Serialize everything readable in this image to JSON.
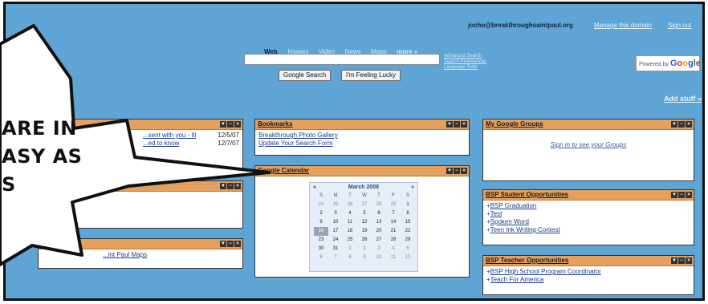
{
  "header": {
    "email": "jocho@breakthroughsaintpaul.org",
    "manage_label": "Manage this domain",
    "signout_label": "Sign out"
  },
  "search": {
    "tabs": [
      "Web",
      "Images",
      "Video",
      "News",
      "Maps",
      "more »"
    ],
    "google_search": "Google Search",
    "lucky": "I'm Feeling Lucky",
    "side_links": [
      "Advanced Search",
      "Search Preferences",
      "Language Tools"
    ],
    "powered_prefix": "Powered by",
    "powered_brand": "Google"
  },
  "add_stuff": "Add stuff »",
  "overlay": {
    "line1": "ARE IN",
    "line2": "ASY AS",
    "line3": "S"
  },
  "left_column": {
    "gadget1": {
      "rows": [
        {
          "text": "...sent with you - Ill",
          "date": "12/5/07"
        },
        {
          "text": "...ed to know",
          "date": "12/7/07"
        }
      ]
    },
    "gadget3": {
      "link": "...int Paul Maps"
    }
  },
  "bookmarks": {
    "title": "Bookmarks",
    "links": [
      "Breakthrough Photo Gallery",
      "Update Your Search Form"
    ]
  },
  "calendar": {
    "title": "Google Calendar",
    "month_label": "March 2008",
    "prev": "«",
    "next": "»",
    "dow": [
      "S",
      "M",
      "T",
      "W",
      "T",
      "F",
      "S"
    ],
    "days": [
      [
        "24",
        "25",
        "26",
        "27",
        "28",
        "29",
        "1"
      ],
      [
        "2",
        "3",
        "4",
        "5",
        "6",
        "7",
        "8"
      ],
      [
        "9",
        "10",
        "11",
        "12",
        "13",
        "14",
        "15"
      ],
      [
        "16",
        "17",
        "18",
        "19",
        "20",
        "21",
        "22"
      ],
      [
        "23",
        "24",
        "25",
        "26",
        "27",
        "28",
        "29"
      ],
      [
        "30",
        "31",
        "1",
        "2",
        "3",
        "4",
        "5"
      ],
      [
        "6",
        "7",
        "8",
        "9",
        "10",
        "11",
        "12"
      ]
    ]
  },
  "groups": {
    "title": "My Google Groups",
    "link": "Sign in to see your Groups"
  },
  "student": {
    "title": "BSP Student Opportunities",
    "items": [
      "BSP Graduation",
      "Test",
      "Spoken Word",
      "Teen Ink Writing Contest"
    ]
  },
  "teacher": {
    "title": "BSP Teacher Opportunities",
    "items": [
      "BSP High School Program Coordinator",
      "Teach For America"
    ]
  },
  "controls": [
    "▼",
    "−",
    "×"
  ],
  "colors": {
    "page_bg": "#5ea5d6",
    "gadget_header": "#e6a05e",
    "link": "#1b3d8c"
  }
}
